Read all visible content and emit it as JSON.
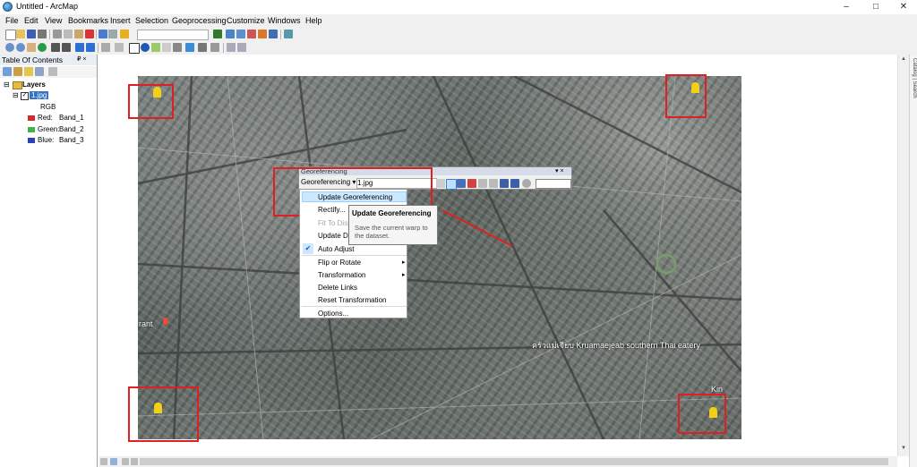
{
  "window": {
    "title": "Untitled - ArcMap",
    "minimize": "–",
    "maximize": "□",
    "close": "✕"
  },
  "menu": [
    "File",
    "Edit",
    "View",
    "Bookmarks",
    "Insert",
    "Selection",
    "Geoprocessing",
    "Customize",
    "Windows",
    "Help"
  ],
  "toc": {
    "title": "Table Of Contents",
    "pin": "₽ ×",
    "layers_label": "Layers",
    "layer_name": "1.jpg",
    "rgb_label": "RGB",
    "bands": [
      {
        "channel": "Red:",
        "band": "Band_1",
        "color": "#d62a2a"
      },
      {
        "channel": "Green:",
        "band": "Band_2",
        "color": "#3fb24a"
      },
      {
        "channel": "Blue:",
        "band": "Band_3",
        "color": "#2f3fb8"
      }
    ]
  },
  "georef_toolbar": {
    "title": "Georeferencing",
    "dropdown_label": "Georeferencing ▾",
    "layer_value": "1.jpg",
    "close": "▾ ×"
  },
  "context_menu": {
    "items": [
      {
        "label": "Update Georeferencing",
        "state": "highlighted"
      },
      {
        "label": "Rectify...",
        "state": "normal"
      },
      {
        "label": "Fit To Display",
        "state": "disabled"
      },
      {
        "label": "Update Display",
        "state": "normal"
      },
      {
        "label": "Auto Adjust",
        "state": "checked"
      },
      {
        "label": "Flip or Rotate",
        "state": "submenu"
      },
      {
        "label": "Transformation",
        "state": "submenu"
      },
      {
        "label": "Delete Links",
        "state": "normal"
      },
      {
        "label": "Reset Transformation",
        "state": "normal"
      },
      {
        "label": "Options...",
        "state": "normal"
      }
    ],
    "check_glyph": "✔",
    "submenu_glyph": "▸"
  },
  "tooltip": {
    "title": "Update Georeferencing",
    "body": "Save the current warp to the dataset."
  },
  "map_labels": {
    "left_label": "rant",
    "cafe_label": "ครัวแม่เจียบ Kruamaejeab southern Thai eatery",
    "right_label": "Kin"
  },
  "right_dock": {
    "label": "Catalog | Search"
  },
  "colors": {
    "highlight_border": "#e02020",
    "menu_highlight": "#cce8ff",
    "tooltip_bg": "#f5f5f5"
  }
}
